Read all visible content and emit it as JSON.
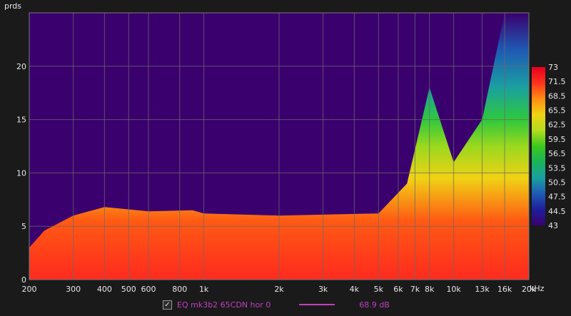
{
  "chart_data": {
    "type": "heatmap",
    "ylabel": "prds",
    "xlabel_unit": "kHz",
    "x_scale": "log",
    "xlim": [
      200,
      20000
    ],
    "ylim": [
      0,
      25
    ],
    "x_ticks": [
      {
        "v": 200,
        "label": "200"
      },
      {
        "v": 300,
        "label": "300"
      },
      {
        "v": 400,
        "label": "400"
      },
      {
        "v": 500,
        "label": "500"
      },
      {
        "v": 600,
        "label": "600"
      },
      {
        "v": 800,
        "label": "800"
      },
      {
        "v": 1000,
        "label": "1k"
      },
      {
        "v": 2000,
        "label": "2k"
      },
      {
        "v": 3000,
        "label": "3k"
      },
      {
        "v": 4000,
        "label": "4k"
      },
      {
        "v": 5000,
        "label": "5k"
      },
      {
        "v": 6000,
        "label": "6k"
      },
      {
        "v": 7000,
        "label": "7k"
      },
      {
        "v": 8000,
        "label": "8k"
      },
      {
        "v": 10000,
        "label": "10k"
      },
      {
        "v": 13000,
        "label": "13k"
      },
      {
        "v": 16000,
        "label": "16k"
      },
      {
        "v": 20000,
        "label": "20k"
      }
    ],
    "y_ticks": [
      0,
      5,
      10,
      15,
      20
    ],
    "grid": true,
    "colorbar": {
      "min": 43,
      "max": 73,
      "ticks": [
        "73",
        "71.5",
        "68.5",
        "65.5",
        "62.5",
        "59.5",
        "56.5",
        "53.5",
        "50.5",
        "47.5",
        "44.5",
        "43"
      ],
      "colors": [
        "#3a006e",
        "#1e1e9a",
        "#1f5ab4",
        "#1aa0a0",
        "#1ab45a",
        "#3cc81e",
        "#b4dc1e",
        "#f0d214",
        "#ff8c14",
        "#ff321e",
        "#e6001e"
      ]
    },
    "decay_profile_periods": [
      {
        "f": 200,
        "top": 3.0
      },
      {
        "f": 230,
        "top": 4.6
      },
      {
        "f": 300,
        "top": 6.0
      },
      {
        "f": 400,
        "top": 6.8
      },
      {
        "f": 600,
        "top": 6.4
      },
      {
        "f": 900,
        "top": 6.5
      },
      {
        "f": 1000,
        "top": 6.2
      },
      {
        "f": 2000,
        "top": 6.0
      },
      {
        "f": 5000,
        "top": 6.2
      },
      {
        "f": 6500,
        "top": 9.0
      },
      {
        "f": 8000,
        "top": 18.0
      },
      {
        "f": 10000,
        "top": 11.0
      },
      {
        "f": 13000,
        "top": 15.0
      },
      {
        "f": 16000,
        "top": 25.0
      },
      {
        "f": 20000,
        "top": 25.0
      }
    ],
    "series": [
      {
        "name": "EQ mk3b2 65CDN hor 0",
        "value": "68.9 dB",
        "color": "#c040c0"
      }
    ]
  }
}
